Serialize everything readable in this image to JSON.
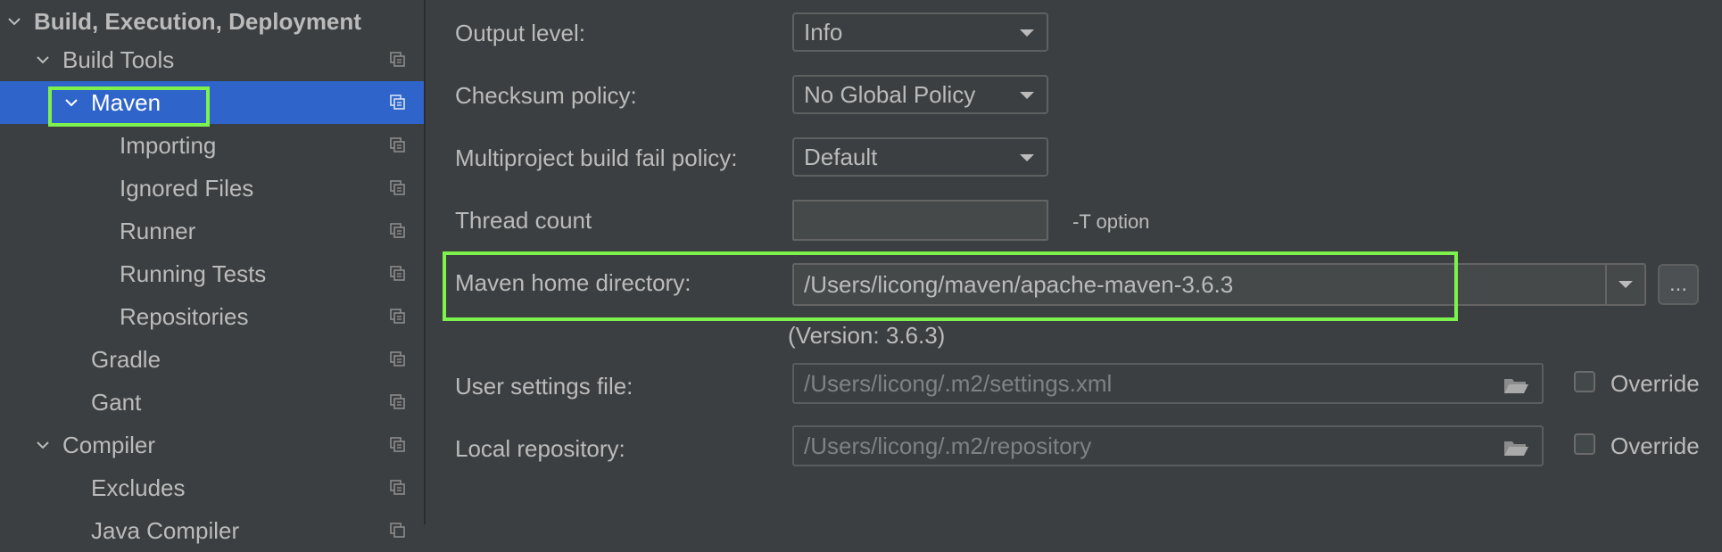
{
  "sidebar": {
    "items": [
      {
        "label": "Build, Execution, Deployment",
        "expanded": true
      },
      {
        "label": "Build Tools",
        "expanded": true
      },
      {
        "label": "Maven",
        "expanded": true,
        "selected": true
      },
      {
        "label": "Importing"
      },
      {
        "label": "Ignored Files"
      },
      {
        "label": "Runner"
      },
      {
        "label": "Running Tests"
      },
      {
        "label": "Repositories"
      },
      {
        "label": "Gradle"
      },
      {
        "label": "Gant"
      },
      {
        "label": "Compiler",
        "expanded": true
      },
      {
        "label": "Excludes"
      },
      {
        "label": "Java Compiler"
      }
    ]
  },
  "form": {
    "output_level": {
      "label": "Output level:",
      "value": "Info"
    },
    "checksum_policy": {
      "label": "Checksum policy:",
      "value": "No Global Policy"
    },
    "multiproject_fail_policy": {
      "label": "Multiproject build fail policy:",
      "value": "Default"
    },
    "thread_count": {
      "label": "Thread count",
      "value": "",
      "hint": "-T option"
    },
    "maven_home": {
      "label": "Maven home directory:",
      "value": "/Users/licong/maven/apache-maven-3.6.3",
      "version": "(Version: 3.6.3)",
      "browse_label": "..."
    },
    "user_settings": {
      "label": "User settings file:",
      "value": "/Users/licong/.m2/settings.xml",
      "override_label": "Override",
      "override_checked": false
    },
    "local_repo": {
      "label": "Local repository:",
      "value": "/Users/licong/.m2/repository",
      "override_label": "Override",
      "override_checked": false
    }
  },
  "colors": {
    "background": "#3c3f41",
    "selection": "#2f65ca",
    "highlight": "#7ef24c"
  },
  "icons": {
    "expand": "chevron-down-icon",
    "copy": "copy-settings-icon",
    "dropdown": "caret-down-icon",
    "folder": "folder-open-icon"
  }
}
